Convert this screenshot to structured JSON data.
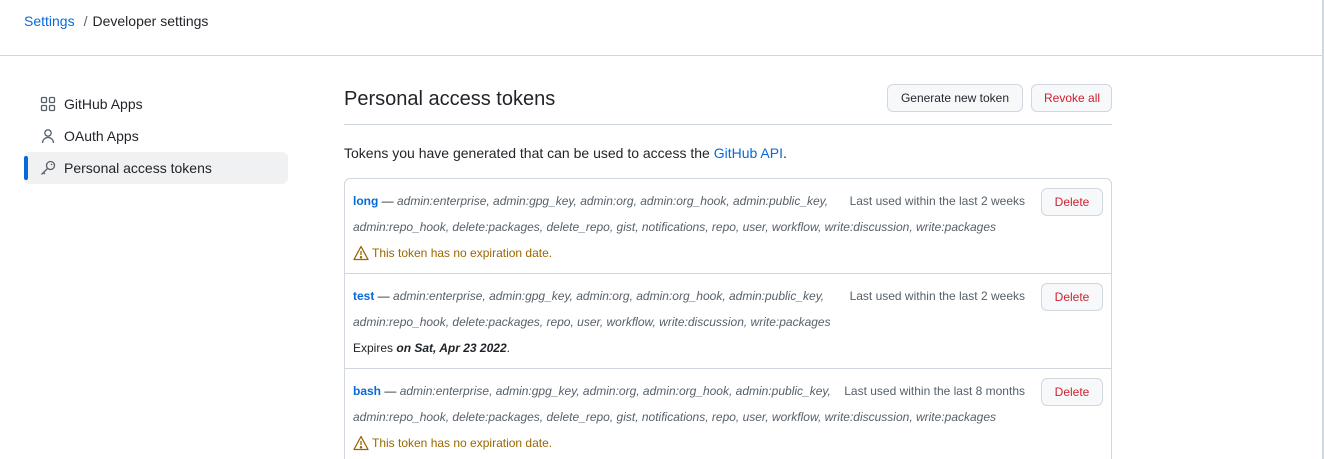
{
  "breadcrumb": {
    "root": "Settings",
    "separator": "/",
    "current": "Developer settings"
  },
  "sidebar": {
    "items": [
      {
        "label": "GitHub Apps",
        "icon": "apps-icon",
        "active": false
      },
      {
        "label": "OAuth Apps",
        "icon": "person-icon",
        "active": false
      },
      {
        "label": "Personal access tokens",
        "icon": "key-icon",
        "active": true
      }
    ]
  },
  "main": {
    "title": "Personal access tokens",
    "generate_label": "Generate new token",
    "revoke_label": "Revoke all",
    "intro_text": "Tokens you have generated that can be used to access the ",
    "intro_link": "GitHub API",
    "intro_end": "."
  },
  "tokens": [
    {
      "name": "long",
      "dash": " — ",
      "scopes_line1": "admin:enterprise, admin:gpg_key, admin:org, admin:org_hook, admin:public_key,",
      "scopes_line2": "admin:repo_hook, delete:packages, delete_repo, gist, notifications, repo, user, workflow, write:discussion, write:packages",
      "last_used": "Last used within the last 2 weeks",
      "status_type": "warning",
      "status_text": "This token has no expiration date.",
      "delete_label": "Delete"
    },
    {
      "name": "test",
      "dash": " — ",
      "scopes_line1": "admin:enterprise, admin:gpg_key, admin:org, admin:org_hook, admin:public_key,",
      "scopes_line2": "admin:repo_hook, delete:packages, repo, user, workflow, write:discussion, write:packages",
      "last_used": "Last used within the last 2 weeks",
      "status_type": "expires",
      "status_prefix": "Expires ",
      "status_date": "on Sat, Apr 23 2022",
      "status_end": ".",
      "delete_label": "Delete"
    },
    {
      "name": "bash",
      "dash": " — ",
      "scopes_line1": "admin:enterprise, admin:gpg_key, admin:org, admin:org_hook, admin:public_key,",
      "scopes_line2": "admin:repo_hook, delete:packages, delete_repo, gist, notifications, repo, user, workflow, write:discussion, write:packages",
      "last_used": "Last used within the last 8 months",
      "status_type": "warning",
      "status_text": "This token has no expiration date.",
      "delete_label": "Delete"
    }
  ],
  "colors": {
    "link": "#0969da",
    "danger": "#cf222e",
    "warning": "#9a6700",
    "border": "#d0d7de"
  }
}
